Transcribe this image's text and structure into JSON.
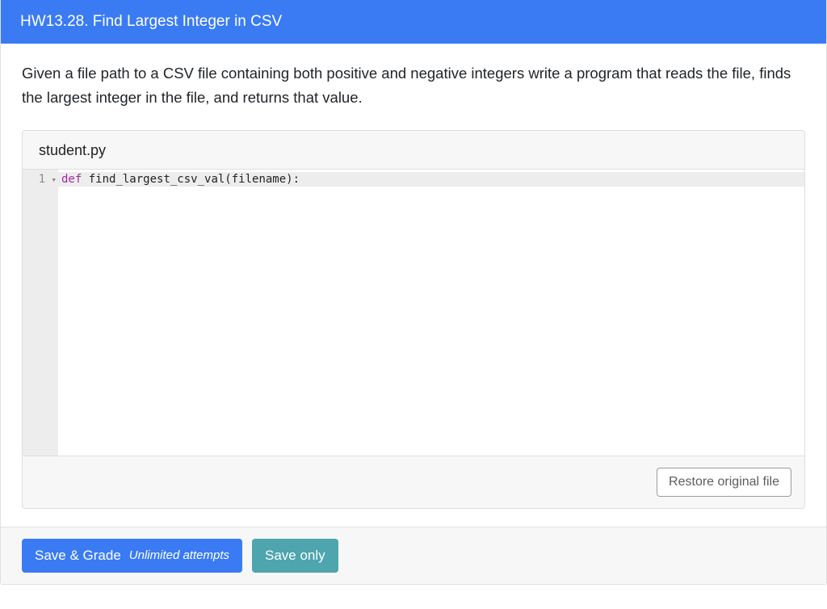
{
  "header": {
    "title": "HW13.28. Find Largest Integer in CSV"
  },
  "prompt": {
    "text": "Given a file path to a CSV file containing both positive and negative integers write a program that reads the file, finds the largest integer in the file, and returns that value."
  },
  "editor": {
    "filename": "student.py",
    "lines": [
      {
        "num": "1",
        "keyword": "def",
        "rest": " find_largest_csv_val(filename):"
      }
    ],
    "restore_label": "Restore original file"
  },
  "footer": {
    "save_grade_label": "Save & Grade",
    "attempts_label": "Unlimited attempts",
    "save_only_label": "Save only"
  }
}
